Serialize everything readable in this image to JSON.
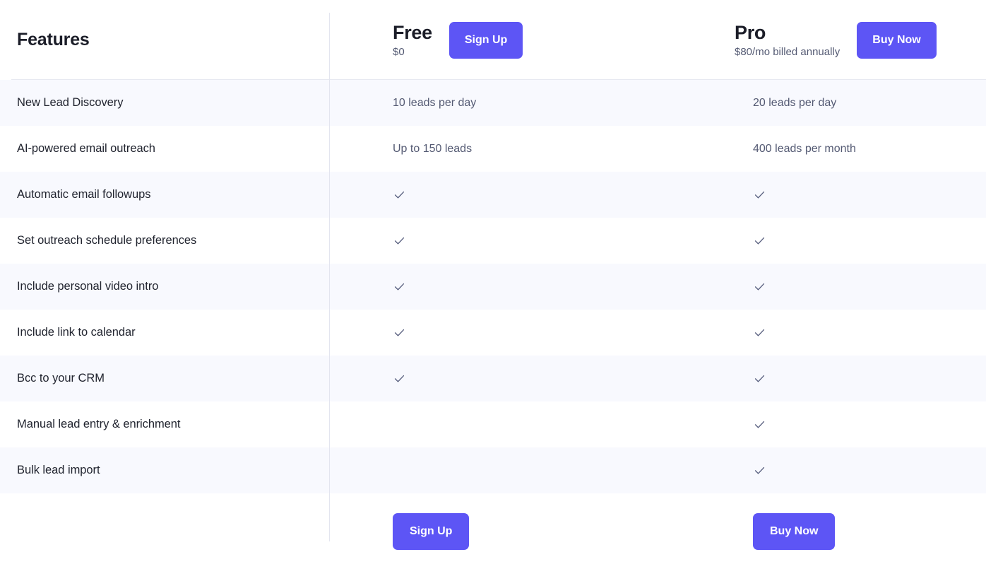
{
  "header": {
    "features_title": "Features",
    "plans": [
      {
        "name": "Free",
        "price": "$0",
        "cta_label": "Sign Up"
      },
      {
        "name": "Pro",
        "price": "$80/mo billed annually",
        "cta_label": "Buy Now"
      }
    ]
  },
  "rows": [
    {
      "label": "New Lead Discovery",
      "free": "10 leads per day",
      "pro": "20 leads per day"
    },
    {
      "label": "AI-powered email outreach",
      "free": "Up to 150 leads",
      "pro": "400 leads per month"
    },
    {
      "label": "Automatic email followups",
      "free": "check",
      "pro": "check"
    },
    {
      "label": "Set outreach schedule preferences",
      "free": "check",
      "pro": "check"
    },
    {
      "label": "Include personal video intro",
      "free": "check",
      "pro": "check"
    },
    {
      "label": "Include link to calendar",
      "free": "check",
      "pro": "check"
    },
    {
      "label": "Bcc to your CRM",
      "free": "check",
      "pro": "check"
    },
    {
      "label": "Manual lead entry & enrichment",
      "free": "",
      "pro": "check"
    },
    {
      "label": "Bulk lead import",
      "free": "",
      "pro": "check"
    }
  ],
  "footer": {
    "free_cta_label": "Sign Up",
    "pro_cta_label": "Buy Now"
  },
  "colors": {
    "accent": "#5d55f5",
    "stripe": "#f8f9fe",
    "divider": "#e3e5ef",
    "heading_text": "#1b1d28",
    "muted_text": "#545a73",
    "check": "#5a6180"
  },
  "icons": {
    "check": "check-icon"
  }
}
